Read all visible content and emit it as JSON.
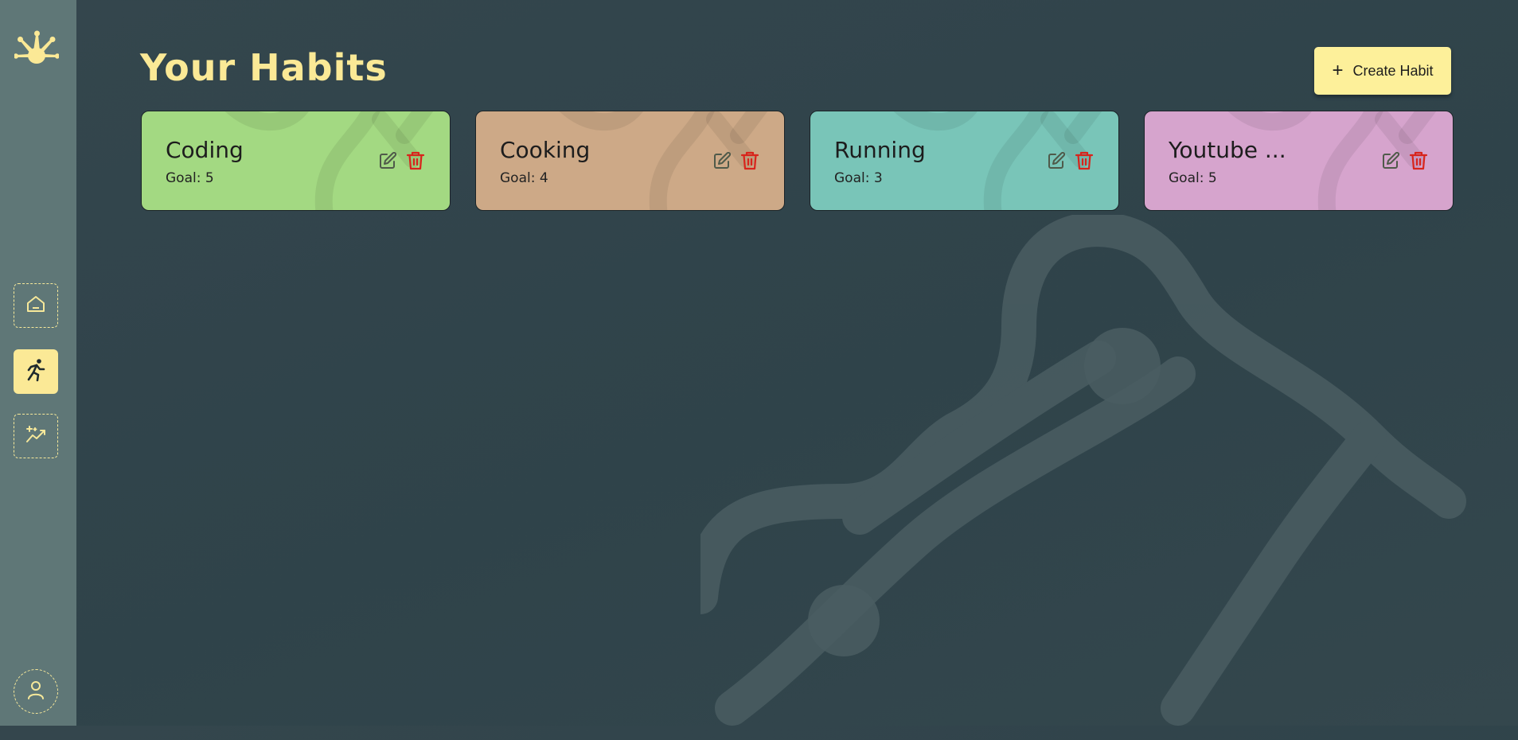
{
  "app": {
    "colors": {
      "background": "#33464c",
      "sidebar": "#5f7777",
      "accent": "#fbe996",
      "create_button": "#fdf09a",
      "delete": "#d8241c"
    }
  },
  "sidebar": {
    "logo_icon": "frog-hand-icon",
    "items": [
      {
        "name": "home",
        "icon": "home-icon",
        "active": false
      },
      {
        "name": "habits",
        "icon": "running-icon",
        "active": true
      },
      {
        "name": "stats",
        "icon": "sparkle-chart-icon",
        "active": false
      }
    ],
    "profile_icon": "user-icon"
  },
  "header": {
    "title": "Your Habits",
    "create_button_label": "Create Habit",
    "create_button_icon": "plus-icon"
  },
  "habits": [
    {
      "name": "Coding",
      "goal": "Goal: 5",
      "color": "#a3d982"
    },
    {
      "name": "Cooking",
      "goal": "Goal: 4",
      "color": "#cda987"
    },
    {
      "name": "Running",
      "goal": "Goal: 3",
      "color": "#79c5b8"
    },
    {
      "name": "Youtube ...",
      "goal": "Goal: 5",
      "color": "#d6a4cd"
    }
  ]
}
